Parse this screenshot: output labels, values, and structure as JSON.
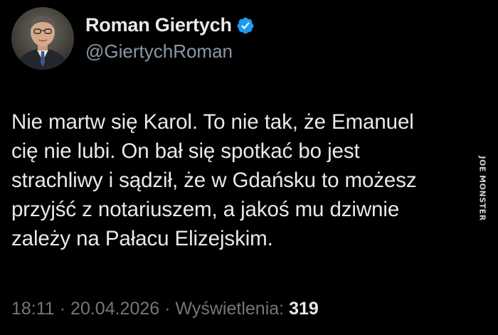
{
  "author": {
    "display_name": "Roman Giertych",
    "handle": "@GiertychRoman",
    "verified": true,
    "verified_icon": "verified-badge-icon",
    "avatar": "profile-photo"
  },
  "post": {
    "text": "Nie martw się Karol. To nie tak, że Emanuel\ncię nie lubi. On bał się spotkać bo jest\nstrachliwy i sądził, że w Gdańsku to możesz\nprzyjść z notariuszem, a jakoś mu dziwnie\nzależy na Pałacu Elizejskim."
  },
  "meta": {
    "time": "18:11",
    "separator": "·",
    "date": "20.04.2026",
    "views_label": "Wyświetlenia:",
    "views_count": "319"
  },
  "watermark": {
    "text": "JOE MONSTER"
  },
  "colors": {
    "background": "#000000",
    "primary_text": "#e7e9ea",
    "secondary_text": "#71767b",
    "verified_blue": "#1d9bf0"
  }
}
